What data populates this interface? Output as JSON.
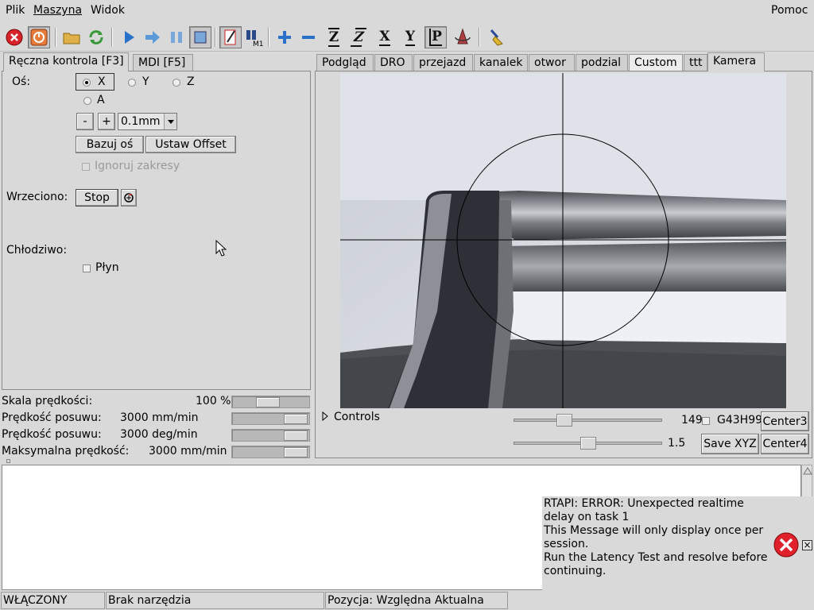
{
  "menubar": {
    "items": [
      "Plik",
      "Maszyna",
      "Widok"
    ],
    "help": "Pomoc"
  },
  "toolbar": {
    "icons": [
      "estop-icon",
      "machine-power-icon",
      "open-file-icon",
      "reload-icon",
      "run-icon",
      "step-icon",
      "pause-icon",
      "stop-program-icon",
      "block-delete-icon",
      "optional-stop-icon",
      "zoom-in-icon",
      "zoom-out-icon",
      "view-z-icon",
      "view-z2-icon",
      "view-x-icon",
      "view-y-icon",
      "view-p-icon",
      "rotate-view-icon",
      "clear-plot-icon"
    ],
    "axis_letters": {
      "z": "Z",
      "z2": "Z",
      "x": "X",
      "y": "Y",
      "p": "P"
    },
    "m1_label": "M1"
  },
  "left_tabs": [
    {
      "label": "Ręczna kontrola [F3]"
    },
    {
      "label": "MDI [F5]"
    }
  ],
  "manual": {
    "axis_label": "Oś:",
    "axes": [
      "X",
      "Y",
      "Z",
      "A"
    ],
    "selected_axis": "X",
    "minus": "-",
    "plus": "+",
    "increment": "0.1mm",
    "home_button": "Bazuj oś",
    "offset_button": "Ustaw Offset",
    "ignore_limits": "Ignoruj zakresy",
    "spindle_label": "Wrzeciono:",
    "spindle_stop": "Stop",
    "coolant_label": "Chłodziwo:",
    "flood": "Płyn"
  },
  "overrides": [
    {
      "label": "Skala prędkości:",
      "value": "100 %",
      "fraction": 0.45
    },
    {
      "label": "Prędkość posuwu:",
      "value": "3000 mm/min",
      "fraction": 0.97
    },
    {
      "label": "Prędkość posuwu:",
      "value": "3000 deg/min",
      "fraction": 0.97
    },
    {
      "label": "Maksymalna prędkość:",
      "value": "3000 mm/min",
      "fraction": 0.97
    }
  ],
  "right_tabs": [
    {
      "label": "Podgląd"
    },
    {
      "label": "DRO"
    },
    {
      "label": "przejazd"
    },
    {
      "label": "kanalek"
    },
    {
      "label": "otwor"
    },
    {
      "label": "podzial"
    },
    {
      "label": "Custom"
    },
    {
      "label": "ttt"
    },
    {
      "label": "Kamera"
    }
  ],
  "camera": {
    "controls_label": "Controls",
    "slider1_value": "149",
    "slider1_fraction": 0.32,
    "slider2_value": "1.5",
    "slider2_fraction": 0.5,
    "g43_label": "G43H99",
    "center3": "Center3",
    "center4": "Center4",
    "save_xyz": "Save XYZ"
  },
  "error": {
    "lines": [
      "RTAPI: ERROR: Unexpected realtime",
      "delay on task 1",
      "This Message will only display once per",
      "session.",
      "Run the Latency Test and resolve before",
      "continuing."
    ],
    "close": "×"
  },
  "statusbar": {
    "state": "WŁĄCZONY",
    "tool": "Brak narzędzia",
    "position": "Pozycja: Względna Aktualna"
  }
}
